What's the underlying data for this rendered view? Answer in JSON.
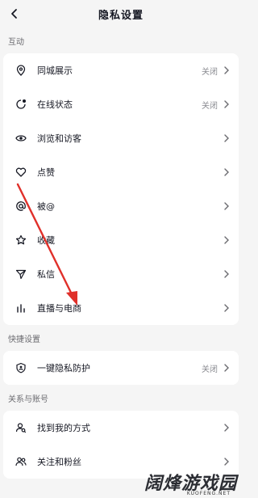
{
  "header": {
    "title": "隐私设置"
  },
  "sections": [
    {
      "label": "互动",
      "items": [
        {
          "label": "同城展示",
          "value": "关闭",
          "icon": "location-pin-icon"
        },
        {
          "label": "在线状态",
          "value": "关闭",
          "icon": "online-status-icon"
        },
        {
          "label": "浏览和访客",
          "value": "",
          "icon": "eye-icon"
        },
        {
          "label": "点赞",
          "value": "",
          "icon": "heart-icon"
        },
        {
          "label": "被@",
          "value": "",
          "icon": "at-icon"
        },
        {
          "label": "收藏",
          "value": "",
          "icon": "star-icon"
        },
        {
          "label": "私信",
          "value": "",
          "icon": "send-icon"
        },
        {
          "label": "直播与电商",
          "value": "",
          "icon": "bars-icon"
        }
      ]
    },
    {
      "label": "快捷设置",
      "items": [
        {
          "label": "一键隐私防护",
          "value": "关闭",
          "icon": "shield-icon"
        }
      ]
    },
    {
      "label": "关系与账号",
      "items": [
        {
          "label": "找到我的方式",
          "value": "",
          "icon": "find-user-icon"
        },
        {
          "label": "关注和粉丝",
          "value": "",
          "icon": "followers-icon"
        }
      ]
    }
  ],
  "watermark": {
    "text": "阔烽游戏园",
    "sub": "KUOFENG.NET"
  },
  "annotation": {
    "color": "#e0302a"
  }
}
